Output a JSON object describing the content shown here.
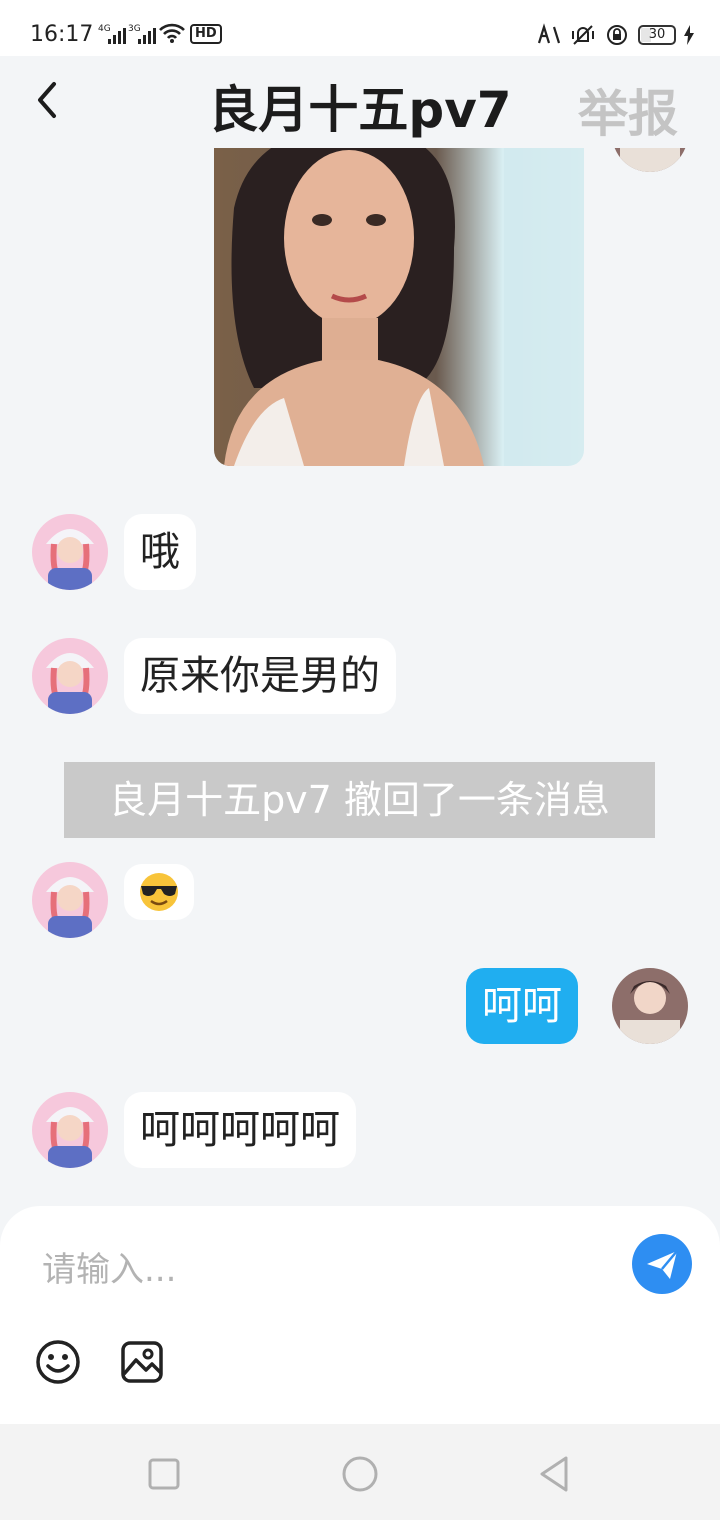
{
  "status_bar": {
    "time": "16:17",
    "sim1": "4G",
    "sim2": "3G",
    "hd": "HD",
    "battery": "30"
  },
  "header": {
    "title": "良月十五pv7",
    "report_label": "举报"
  },
  "messages": [
    {
      "text": "哦"
    },
    {
      "text": "原来你是男的"
    },
    {
      "recall_notice": "良月十五pv7 撤回了一条消息"
    },
    {
      "emoji": "sunglasses-emoji"
    },
    {
      "text": "呵呵"
    },
    {
      "text": "呵呵呵呵呵"
    }
  ],
  "input": {
    "placeholder": "请输入..."
  },
  "colors": {
    "accent": "#20aef0",
    "send_button": "#2e8ef2",
    "recall_bg": "#c9c9c9",
    "report": "#c4c4c4"
  }
}
